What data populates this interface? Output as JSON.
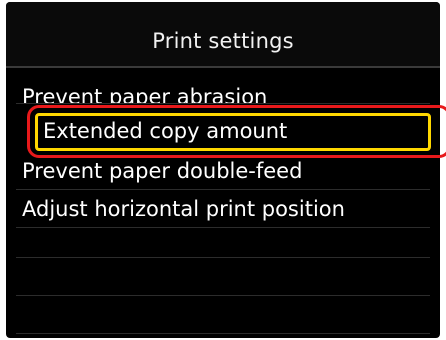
{
  "screen": {
    "title": "Print settings"
  },
  "menu": {
    "items": [
      {
        "label": "Prevent paper abrasion",
        "selected": false
      },
      {
        "label": "Extended copy amount",
        "selected": true
      },
      {
        "label": "Prevent paper double-feed",
        "selected": false
      },
      {
        "label": "Adjust horizontal print position",
        "selected": false
      }
    ]
  },
  "colors": {
    "screen_background": "#000000",
    "text": "#ffffff",
    "selection_border": "#ffd800",
    "callout_ring": "#e8191b"
  }
}
